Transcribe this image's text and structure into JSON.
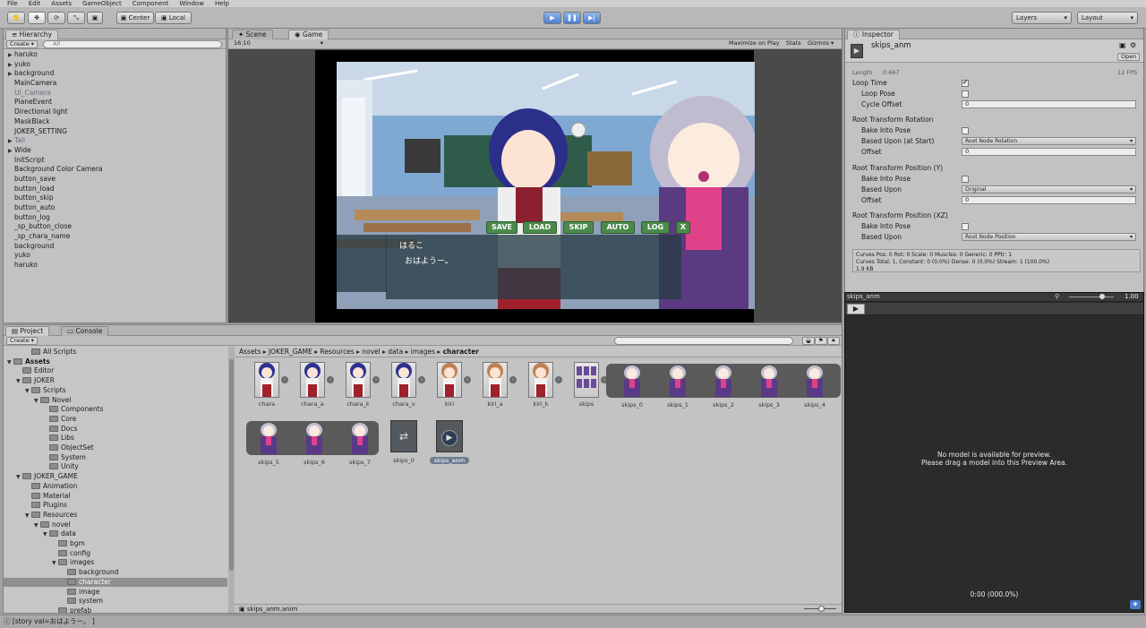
{
  "menu": [
    "File",
    "Edit",
    "Assets",
    "GameObject",
    "Component",
    "Window",
    "Help"
  ],
  "toolbar": {
    "center": "Center",
    "local": "Local",
    "layers": "Layers",
    "layout": "Layout"
  },
  "hierarchy": {
    "title": "Hierarchy",
    "create": "Create",
    "search": "All",
    "items": [
      {
        "label": "haruko",
        "arrow": true,
        "dim": false
      },
      {
        "label": "yuko",
        "arrow": true,
        "dim": false
      },
      {
        "label": "background",
        "arrow": true,
        "dim": false
      },
      {
        "label": "MainCamera",
        "arrow": false,
        "dim": false
      },
      {
        "label": "UI_Camera",
        "arrow": false,
        "dim": true
      },
      {
        "label": "PlaneEvent",
        "arrow": false,
        "dim": false
      },
      {
        "label": "Directional light",
        "arrow": false,
        "dim": false
      },
      {
        "label": "MaskBlack",
        "arrow": false,
        "dim": false
      },
      {
        "label": "JOKER_SETTING",
        "arrow": false,
        "dim": false
      },
      {
        "label": "Tall",
        "arrow": true,
        "dim": true
      },
      {
        "label": "Wide",
        "arrow": true,
        "dim": false
      },
      {
        "label": "InitScript",
        "arrow": false,
        "dim": false
      },
      {
        "label": "Background Color Camera",
        "arrow": false,
        "dim": false
      },
      {
        "label": "button_save",
        "arrow": false,
        "dim": false
      },
      {
        "label": "button_load",
        "arrow": false,
        "dim": false
      },
      {
        "label": "button_skip",
        "arrow": false,
        "dim": false
      },
      {
        "label": "button_auto",
        "arrow": false,
        "dim": false
      },
      {
        "label": "button_log",
        "arrow": false,
        "dim": false
      },
      {
        "label": "_sp_button_close",
        "arrow": false,
        "dim": false
      },
      {
        "label": "_sp_chara_name",
        "arrow": false,
        "dim": false
      },
      {
        "label": "background",
        "arrow": false,
        "dim": false
      },
      {
        "label": "yuko",
        "arrow": false,
        "dim": false
      },
      {
        "label": "haruko",
        "arrow": false,
        "dim": false
      }
    ]
  },
  "scene": {
    "scene_tab": "Scene",
    "game_tab": "Game",
    "aspect": "16:10",
    "maximize": "Maximize on Play",
    "stats": "Stats",
    "gizmos": "Gizmos"
  },
  "game": {
    "buttons": [
      "SAVE",
      "LOAD",
      "SKIP",
      "AUTO",
      "LOG",
      "X"
    ],
    "speaker": "はるこ",
    "line": "おはようー。"
  },
  "inspector": {
    "title": "Inspector",
    "asset_name": "skips_anm",
    "open": "Open",
    "length_label": "Length",
    "length": "0.667",
    "fps": "12 FPS",
    "loop_time": "Loop Time",
    "loop_pose": "Loop Pose",
    "cycle_offset": "Cycle Offset",
    "cycle_offset_val": "0",
    "rtr": "Root Transform Rotation",
    "bake_rot": "Bake Into Pose",
    "based_rot": "Based Upon (at Start)",
    "based_rot_val": "Root Node Rotation",
    "offset_rot": "Offset",
    "offset_rot_val": "0",
    "rtpy": "Root Transform Position (Y)",
    "bake_y": "Bake Into Pose",
    "based_y": "Based Upon",
    "based_y_val": "Original",
    "offset_y": "Offset",
    "offset_y_val": "0",
    "rtpxz": "Root Transform Position (XZ)",
    "bake_xz": "Bake Into Pose",
    "based_xz": "Based Upon",
    "based_xz_val": "Root Node Position",
    "info1": "Curves Pos: 0 Rot: 0 Scale: 0 Muscles: 0 Generic: 0 PPtr: 1",
    "info2": "Curves Total: 1, Constant: 0 (0.0%) Dense: 0 (0.0%) Stream: 1 (100.0%)",
    "info3": "1.9 KB"
  },
  "preview": {
    "name": "skips_anm",
    "speed": "1.00",
    "msg1": "No model is available for preview.",
    "msg2": "Please drag a model into this Preview Area.",
    "time": "0:00 (000.0%)"
  },
  "project": {
    "tab": "Project",
    "console": "Console",
    "create": "Create",
    "breadcrumb": [
      "Assets",
      "JOKER_GAME",
      "Resources",
      "novel",
      "data",
      "images",
      "character"
    ],
    "tree": [
      {
        "label": "All Scripts",
        "d": 2,
        "arrow": false
      },
      {
        "label": "Assets",
        "d": 0,
        "arrow": true,
        "bold": true
      },
      {
        "label": "Editor",
        "d": 1,
        "arrow": false
      },
      {
        "label": "JOKER",
        "d": 1,
        "arrow": true
      },
      {
        "label": "Scripts",
        "d": 2,
        "arrow": true
      },
      {
        "label": "Novel",
        "d": 3,
        "arrow": true
      },
      {
        "label": "Components",
        "d": 4,
        "arrow": false
      },
      {
        "label": "Core",
        "d": 4,
        "arrow": false
      },
      {
        "label": "Docs",
        "d": 4,
        "arrow": false
      },
      {
        "label": "Libs",
        "d": 4,
        "arrow": false
      },
      {
        "label": "ObjectSet",
        "d": 4,
        "arrow": false
      },
      {
        "label": "System",
        "d": 4,
        "arrow": false
      },
      {
        "label": "Unity",
        "d": 4,
        "arrow": false
      },
      {
        "label": "JOKER_GAME",
        "d": 1,
        "arrow": true
      },
      {
        "label": "Animation",
        "d": 2,
        "arrow": false
      },
      {
        "label": "Material",
        "d": 2,
        "arrow": false
      },
      {
        "label": "Plugins",
        "d": 2,
        "arrow": false
      },
      {
        "label": "Resources",
        "d": 2,
        "arrow": true
      },
      {
        "label": "novel",
        "d": 3,
        "arrow": true
      },
      {
        "label": "data",
        "d": 4,
        "arrow": true
      },
      {
        "label": "bgm",
        "d": 5,
        "arrow": false
      },
      {
        "label": "config",
        "d": 5,
        "arrow": false
      },
      {
        "label": "images",
        "d": 5,
        "arrow": true
      },
      {
        "label": "background",
        "d": 6,
        "arrow": false
      },
      {
        "label": "character",
        "d": 6,
        "arrow": false,
        "selected": true
      },
      {
        "label": "image",
        "d": 6,
        "arrow": false
      },
      {
        "label": "system",
        "d": 6,
        "arrow": false
      },
      {
        "label": "prefab",
        "d": 5,
        "arrow": false
      }
    ],
    "assets_row1": [
      "chara",
      "chara_a",
      "chara_k",
      "chara_v",
      "kiri",
      "kiri_a",
      "kiri_k",
      "skips"
    ],
    "sprites_row1": [
      "skips_0",
      "skips_1",
      "skips_2",
      "skips_3",
      "skips_4"
    ],
    "sprites_row2": [
      "skips_5",
      "skips_6",
      "skips_7"
    ],
    "extra": [
      "skips_0",
      "skips_anm"
    ],
    "footer": "skips_anm.anim"
  },
  "status": "[story val=おはようー。 ]"
}
